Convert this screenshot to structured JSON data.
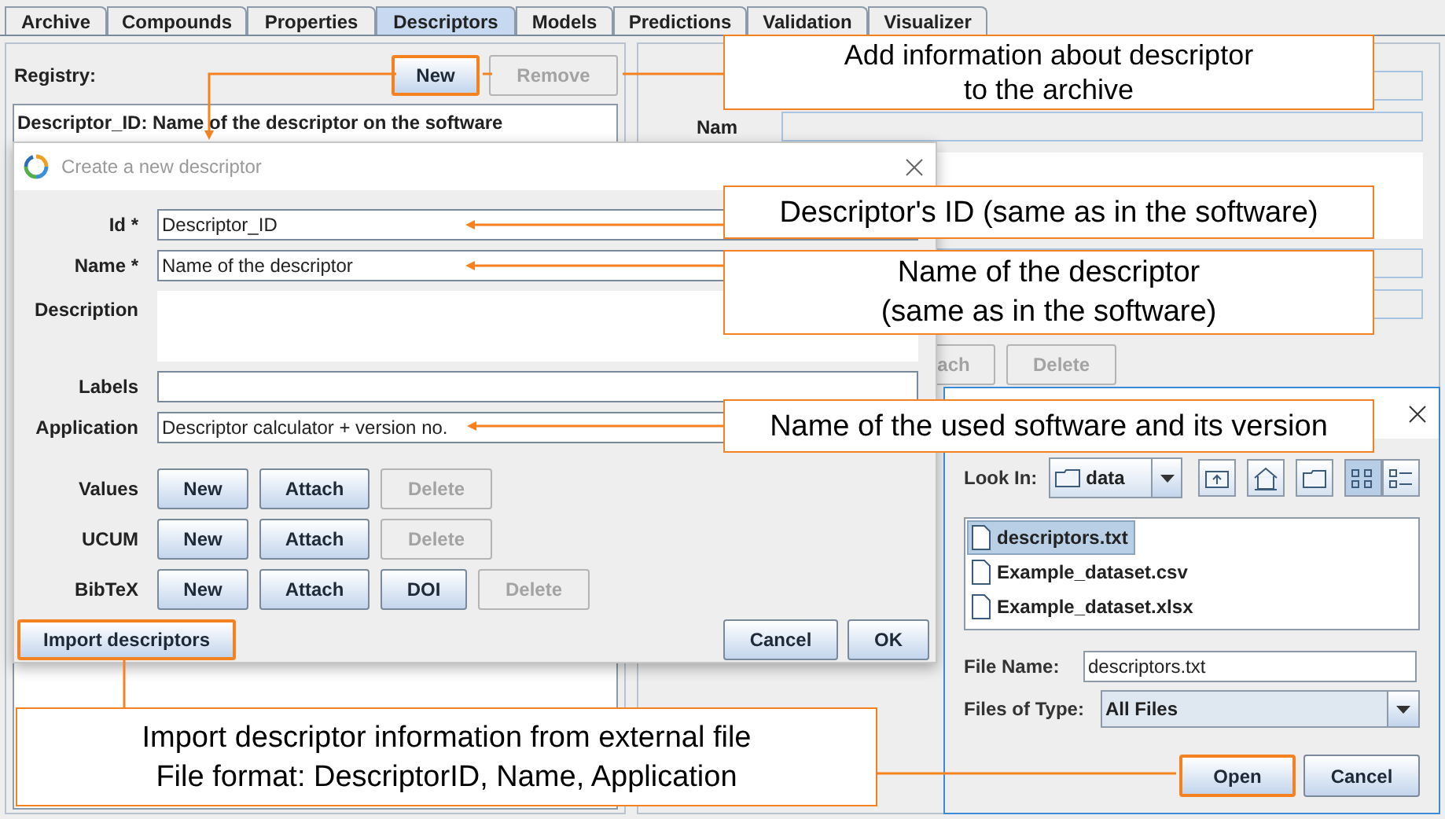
{
  "tabs": [
    {
      "label": "Archive",
      "selected": false
    },
    {
      "label": "Compounds",
      "selected": false
    },
    {
      "label": "Properties",
      "selected": false
    },
    {
      "label": "Descriptors",
      "selected": true
    },
    {
      "label": "Models",
      "selected": false
    },
    {
      "label": "Predictions",
      "selected": false
    },
    {
      "label": "Validation",
      "selected": false
    },
    {
      "label": "Visualizer",
      "selected": false
    }
  ],
  "registry": {
    "label": "Registry:",
    "buttons": [
      {
        "label": "New",
        "disabled": false,
        "highlighted": true
      },
      {
        "label": "Remove",
        "disabled": true,
        "highlighted": false
      }
    ],
    "items": [
      "Descriptor_ID: Name of the descriptor on the software"
    ]
  },
  "right_panel": {
    "label": "Nam",
    "buttons": [
      {
        "label": "ach",
        "disabled": true
      },
      {
        "label": "Delete",
        "disabled": true
      }
    ]
  },
  "dialog": {
    "title": "Create a new descriptor",
    "fields": [
      {
        "label": "Id *",
        "kind": "text",
        "value": "Descriptor_ID"
      },
      {
        "label": "Name *",
        "kind": "text",
        "value": "Name of the descriptor"
      },
      {
        "label": "Description",
        "kind": "textarea"
      },
      {
        "label": "Labels",
        "kind": "text"
      },
      {
        "label": "Application",
        "kind": "text",
        "value": "Descriptor calculator + version no."
      }
    ],
    "button_rows": [
      {
        "label": "Values",
        "buttons": [
          {
            "label": "New",
            "disabled": false
          },
          {
            "label": "Attach",
            "disabled": false
          },
          {
            "label": "Delete",
            "disabled": true
          }
        ]
      },
      {
        "label": "UCUM",
        "buttons": [
          {
            "label": "New",
            "disabled": false
          },
          {
            "label": "Attach",
            "disabled": false
          },
          {
            "label": "Delete",
            "disabled": true
          }
        ]
      },
      {
        "label": "BibTeX",
        "buttons": [
          {
            "label": "New",
            "disabled": false
          },
          {
            "label": "Attach",
            "disabled": false
          },
          {
            "label": "DOI",
            "disabled": false
          },
          {
            "label": "Delete",
            "disabled": true
          }
        ]
      }
    ],
    "import_button": {
      "label": "Import descriptors",
      "highlighted": true
    },
    "actions": [
      {
        "label": "Cancel"
      },
      {
        "label": "OK"
      }
    ]
  },
  "file_dialog": {
    "look_in_label": "Look In:",
    "look_in_value": "data",
    "toolbar": [
      {
        "kind": "up",
        "selected": false
      },
      {
        "kind": "home",
        "selected": false
      },
      {
        "kind": "new_folder",
        "selected": false
      },
      {
        "kind": "list",
        "selected": true
      },
      {
        "kind": "details",
        "selected": false
      }
    ],
    "files": [
      {
        "name": "descriptors.txt",
        "selected": true
      },
      {
        "name": "Example_dataset.csv",
        "selected": false
      },
      {
        "name": "Example_dataset.xlsx",
        "selected": false
      }
    ],
    "file_name_label": "File Name:",
    "file_name": "descriptors.txt",
    "type_label": "Files of Type:",
    "type_value": "All Files",
    "buttons": [
      {
        "label": "Open",
        "highlighted": true
      },
      {
        "label": "Cancel",
        "highlighted": false
      }
    ]
  },
  "callouts": [
    {
      "text": "Add information about descriptor\nto the archive"
    },
    {
      "text": "Descriptor's ID (same as in the software)"
    },
    {
      "text": "Name of the descriptor\n(same as in the software)"
    },
    {
      "text": "Name of the used software and its version"
    },
    {
      "text": "Import descriptor information from external file\nFile format: DescriptorID, Name, Application"
    }
  ]
}
